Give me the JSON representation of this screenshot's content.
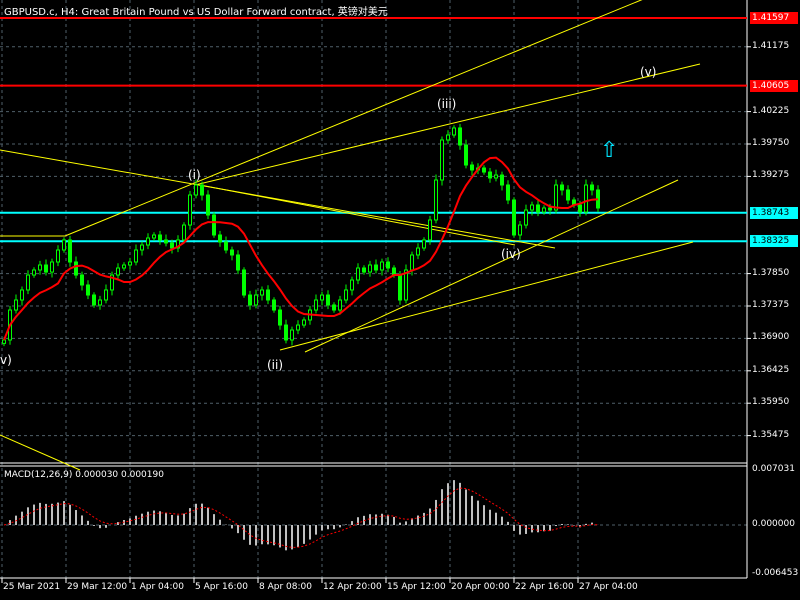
{
  "header": {
    "title": "GBPUSD.c, H4:  Great Britain Pound vs US Dollar Forward contract, 英镑对美元"
  },
  "macd_panel": {
    "label": "MACD(12,26,9) 0.000030 0.000190",
    "axis": [
      "0.007031",
      "0.000000",
      "-0.006453"
    ],
    "range": [
      -0.006453,
      0.007031
    ]
  },
  "colors": {
    "up": "#00ff00",
    "down": "#00ff00",
    "ma": "#ff0000",
    "hline_red": "#ff0000",
    "hline_cyan": "#00ffff",
    "trend": "#ffff00",
    "grid": "#50606a"
  },
  "chart_data": {
    "type": "candlestick",
    "symbol": "GBPUSD.c",
    "timeframe": "H4",
    "ylim": [
      1.351,
      1.41861
    ],
    "y_ticks": [
      "1.41175",
      "1.40225",
      "1.39750",
      "1.39275",
      "1.37850",
      "1.37375",
      "1.36900",
      "1.36425",
      "1.35950",
      "1.35475"
    ],
    "x_ticks": [
      "25 Mar 2021",
      "29 Mar 12:00",
      "1 Apr 04:00",
      "5 Apr 16:00",
      "8 Apr 08:00",
      "12 Apr 20:00",
      "15 Apr 12:00",
      "20 Apr 00:00",
      "22 Apr 16:00",
      "27 Apr 04:00"
    ],
    "closes": [
      1.36877,
      1.37316,
      1.37463,
      1.3761,
      1.37829,
      1.37903,
      1.37976,
      1.37873,
      1.3802,
      1.38196,
      1.38343,
      1.3802,
      1.37829,
      1.37683,
      1.37536,
      1.3739,
      1.37463,
      1.3761,
      1.37829,
      1.37932,
      1.37976,
      1.3802,
      1.38196,
      1.38269,
      1.38372,
      1.38416,
      1.38343,
      1.38299,
      1.38225,
      1.38343,
      1.38562,
      1.39002,
      1.39149,
      1.39002,
      1.38709,
      1.38416,
      1.38313,
      1.38196,
      1.38123,
      1.37903,
      1.37536,
      1.3739,
      1.37536,
      1.3761,
      1.37463,
      1.37316,
      1.37096,
      1.36877,
      1.37023,
      1.37096,
      1.3717,
      1.37316,
      1.37463,
      1.37536,
      1.3739,
      1.37316,
      1.37463,
      1.3761,
      1.37756,
      1.37932,
      1.37873,
      1.37976,
      1.37903,
      1.3802,
      1.37932,
      1.37829,
      1.37463,
      1.37903,
      1.38123,
      1.38225,
      1.38343,
      1.38636,
      1.39222,
      1.39809,
      1.39882,
      1.39985,
      1.39735,
      1.39442,
      1.39369,
      1.39398,
      1.39339,
      1.39252,
      1.39295,
      1.39149,
      1.38929,
      1.38416,
      1.38562,
      1.38782,
      1.38856,
      1.38753,
      1.38812,
      1.38782,
      1.39149,
      1.39076,
      1.38929,
      1.38856,
      1.38753,
      1.39149,
      1.39076,
      1.38812
    ],
    "horizontal_lines": [
      {
        "price": "1.41597",
        "color": "red"
      },
      {
        "price": "1.40605",
        "color": "red"
      },
      {
        "price": "1.38743",
        "color": "cyan"
      },
      {
        "price": "1.38325",
        "color": "cyan"
      }
    ],
    "wave_labels": [
      "v)",
      "(i)",
      "(ii)",
      "(iii)",
      "(iv)",
      "(v)"
    ]
  }
}
